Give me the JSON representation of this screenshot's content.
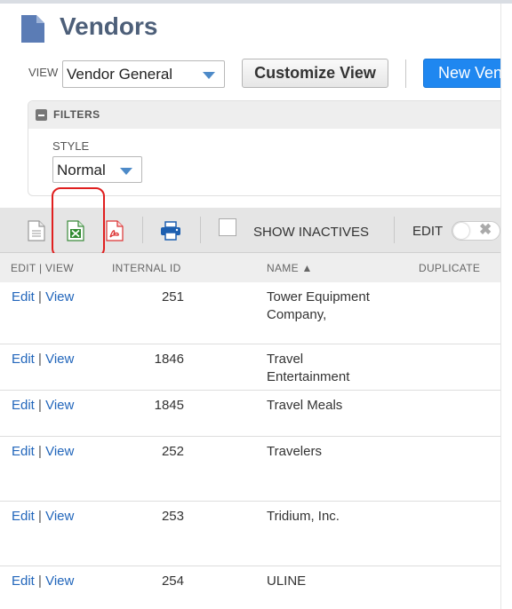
{
  "page": {
    "title": "Vendors"
  },
  "view": {
    "label": "VIEW",
    "selected": "Vendor General"
  },
  "buttons": {
    "customize": "Customize View",
    "new": "New Vendor"
  },
  "filters": {
    "header": "FILTERS",
    "style_label": "STYLE",
    "style_value": "Normal"
  },
  "toolbar": {
    "icons": [
      "export-text-icon",
      "export-excel-icon",
      "export-pdf-icon",
      "print-icon"
    ],
    "show_inactives": "SHOW INACTIVES",
    "edit": "EDIT",
    "toggle_symbol": "✖"
  },
  "table": {
    "columns": [
      "EDIT | VIEW",
      "INTERNAL ID",
      "NAME ▲",
      "DUPLICATE"
    ],
    "rows": [
      {
        "edit": "Edit",
        "view": "View",
        "id": "251",
        "name": "Tower Equipment Company,"
      },
      {
        "edit": "Edit",
        "view": "View",
        "id": "1846",
        "name": "Travel Entertainment"
      },
      {
        "edit": "Edit",
        "view": "View",
        "id": "1845",
        "name": "Travel Meals"
      },
      {
        "edit": "Edit",
        "view": "View",
        "id": "252",
        "name": "Travelers"
      },
      {
        "edit": "Edit",
        "view": "View",
        "id": "253",
        "name": "Tridium, Inc."
      },
      {
        "edit": "Edit",
        "view": "View",
        "id": "254",
        "name": "ULINE"
      }
    ]
  },
  "colors": {
    "accent": "#1f87f0",
    "title": "#4d5f79",
    "link": "#2266bb",
    "highlight": "#e01f1f"
  }
}
